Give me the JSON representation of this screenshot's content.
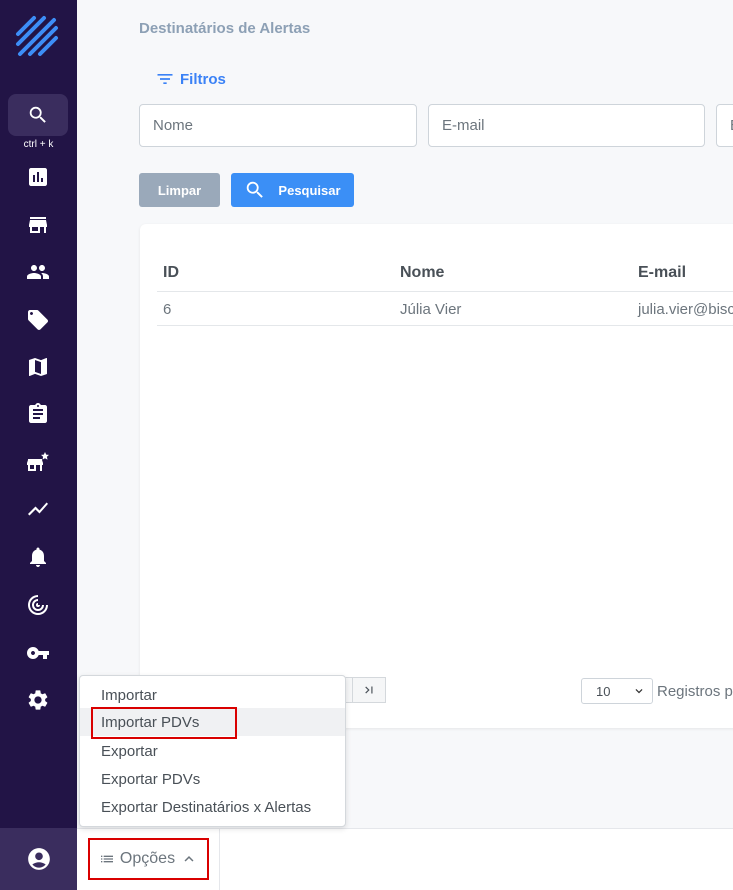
{
  "sidebar": {
    "search_hint": "ctrl + k",
    "icons": [
      "search-icon",
      "chart-icon",
      "store-icon",
      "people-icon",
      "tag-icon",
      "map-icon",
      "clipboard-icon",
      "store-star-icon",
      "trend-icon",
      "bell-icon",
      "radar-icon",
      "key-icon",
      "gear-icon",
      "account-icon"
    ]
  },
  "page": {
    "title": "Destinatários de Alertas"
  },
  "filters": {
    "toggle_label": "Filtros",
    "name_placeholder": "Nome",
    "email_placeholder": "E-mail",
    "third_placeholder": "E",
    "clear_label": "Limpar",
    "search_label": "Pesquisar"
  },
  "table": {
    "columns": [
      "ID",
      "Nome",
      "E-mail"
    ],
    "rows": [
      {
        "id": "6",
        "name": "Júlia Vier",
        "email": "julia.vier@bisc"
      }
    ]
  },
  "pagination": {
    "page_size": "10",
    "records_label": "Registros p"
  },
  "options_menu": {
    "button_label": "Opções",
    "items": [
      "Importar",
      "Importar PDVs",
      "Exportar",
      "Exportar PDVs",
      "Exportar Destinatários x Alertas"
    ]
  },
  "colors": {
    "sidebar": "#221446",
    "accent": "#3b8ff6",
    "highlight": "#d90000"
  }
}
